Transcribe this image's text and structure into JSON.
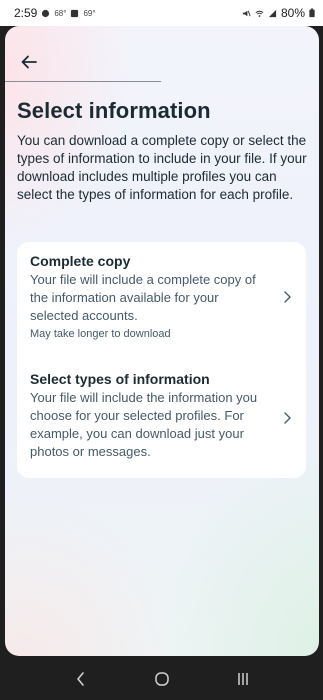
{
  "status_bar": {
    "time": "2:59",
    "temp1": "68°",
    "temp2": "69°",
    "battery": "80%"
  },
  "header": {
    "back_icon": "arrow-left-icon"
  },
  "page": {
    "title": "Select information",
    "description": "You can download a complete copy or select the types of information to include in your file. If your download includes multiple profiles you can select the types of information for each profile."
  },
  "options": [
    {
      "title": "Complete copy",
      "description": "Your file will include a complete copy of the information available for your selected accounts.",
      "note": "May take longer to download",
      "icon": "chevron-right-icon"
    },
    {
      "title": "Select types of information",
      "description": "Your file will include the information you choose for your selected profiles. For example, you can download just your photos or messages.",
      "icon": "chevron-right-icon"
    }
  ],
  "nav_bar": {
    "back": "back-icon",
    "home": "home-icon",
    "recents": "recents-icon"
  }
}
